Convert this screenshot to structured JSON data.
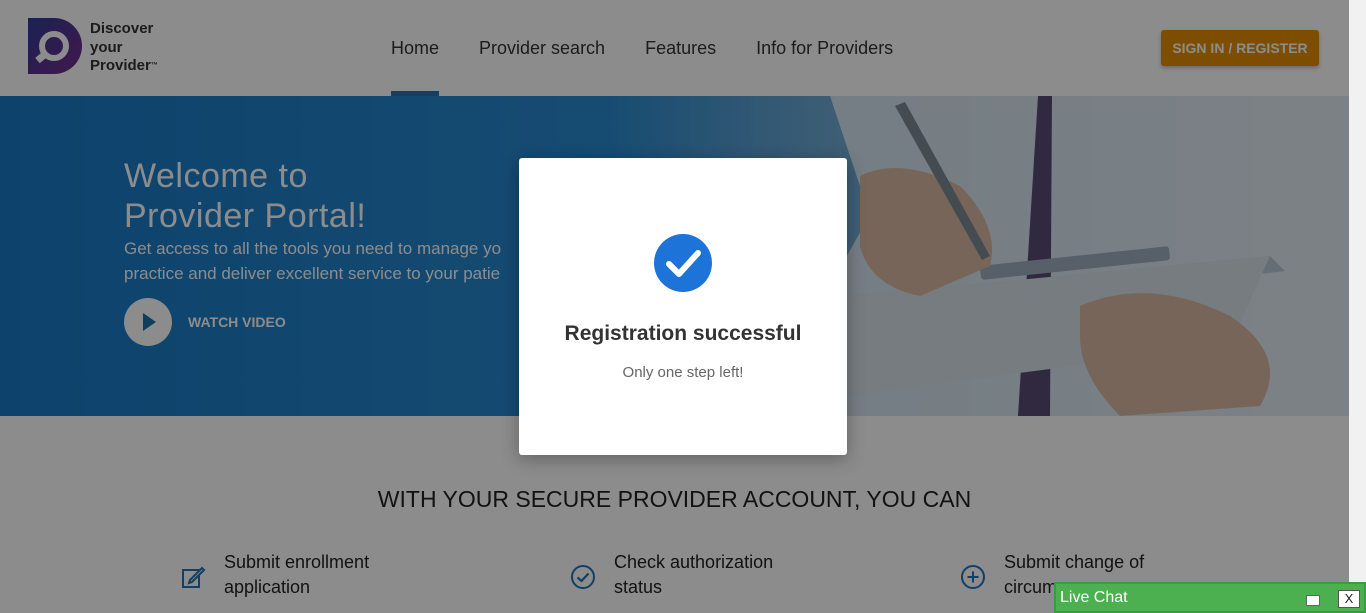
{
  "brand": {
    "line1": "Discover",
    "line2": "your",
    "line3": "Provider",
    "trademark": "™",
    "colors": {
      "purple": "#6a2c8c",
      "blue": "#2e3f9a"
    }
  },
  "nav": {
    "items": [
      {
        "label": "Home",
        "active": true
      },
      {
        "label": "Provider search",
        "active": false
      },
      {
        "label": "Features",
        "active": false
      },
      {
        "label": "Info for Providers",
        "active": false
      }
    ],
    "signin_label": "SIGN IN / REGISTER"
  },
  "hero": {
    "title_line1": "Welcome to",
    "title_line2": "Provider Portal!",
    "subtitle_line1": "Get access to all the tools you need to manage yo",
    "subtitle_line2": "practice and deliver excellent service to your patie",
    "video_label": "WATCH VIDEO"
  },
  "section": {
    "title": "WITH YOUR SECURE PROVIDER ACCOUNT, YOU CAN",
    "features": [
      {
        "icon": "edit-icon",
        "line1": "Submit enrollment",
        "line2": "application"
      },
      {
        "icon": "check-circle-icon",
        "line1": "Check authorization",
        "line2": "status"
      },
      {
        "icon": "plus-circle-icon",
        "line1": "Submit change of",
        "line2": "circum"
      }
    ]
  },
  "modal": {
    "icon": "check-circle-icon",
    "title": "Registration successful",
    "subtitle": "Only one step left!"
  },
  "chat": {
    "label": "Live Chat",
    "close_label": "X"
  },
  "colors": {
    "accent_blue": "#1e73be",
    "signin_orange": "#e58e00",
    "chat_green": "#4caf50"
  }
}
